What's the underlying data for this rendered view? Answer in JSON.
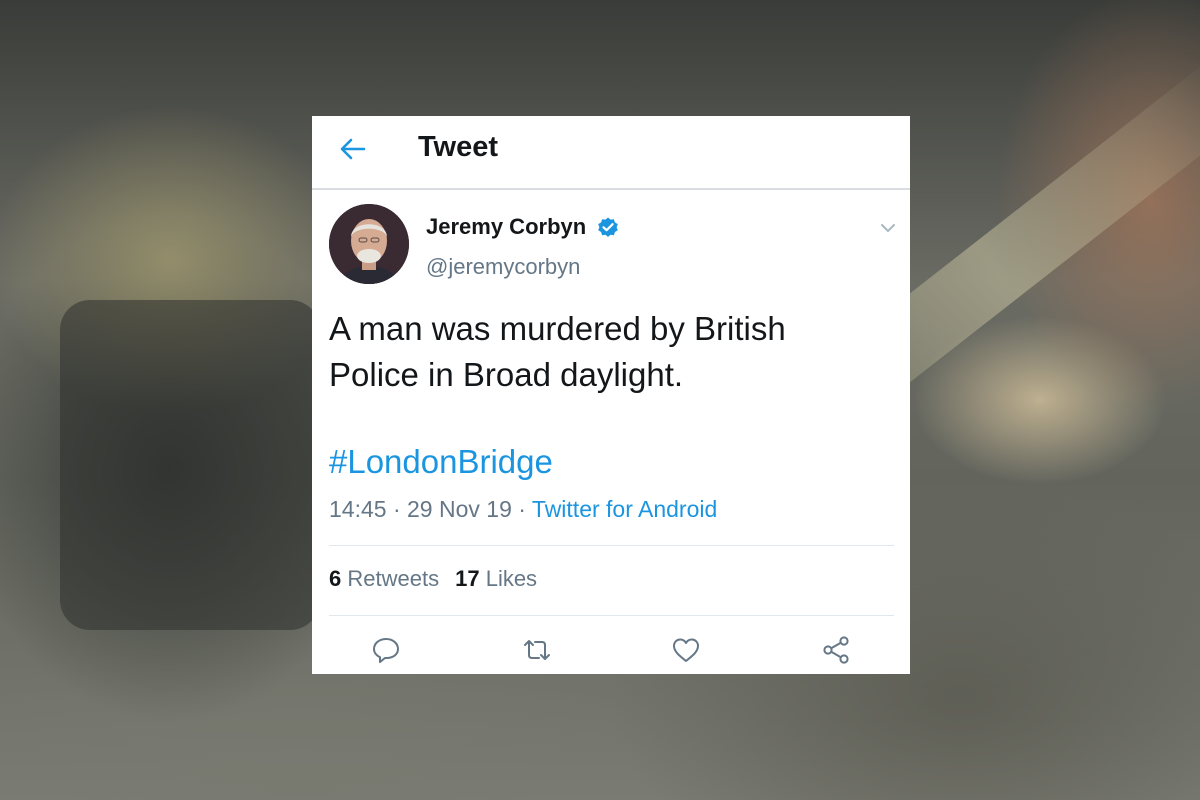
{
  "header": {
    "title": "Tweet",
    "back_icon": "back-arrow-icon"
  },
  "tweet": {
    "author_name": "Jeremy Corbyn",
    "author_handle": "@jeremycorbyn",
    "verified": true,
    "text_line1": "A man was murdered by British",
    "text_line2": "Police in Broad daylight.",
    "hashtag": "#LondonBridge",
    "time": "14:45",
    "date": "29 Nov 19",
    "separator": "·",
    "source": "Twitter for Android",
    "retweets_count": "6",
    "retweets_label": "Retweets",
    "likes_count": "17",
    "likes_label": "Likes"
  },
  "actions": [
    "reply-icon",
    "retweet-icon",
    "like-icon",
    "share-icon"
  ],
  "colors": {
    "accent": "#1b95e0",
    "text": "#14171a",
    "muted": "#657786",
    "divider": "#e1e8ed"
  }
}
